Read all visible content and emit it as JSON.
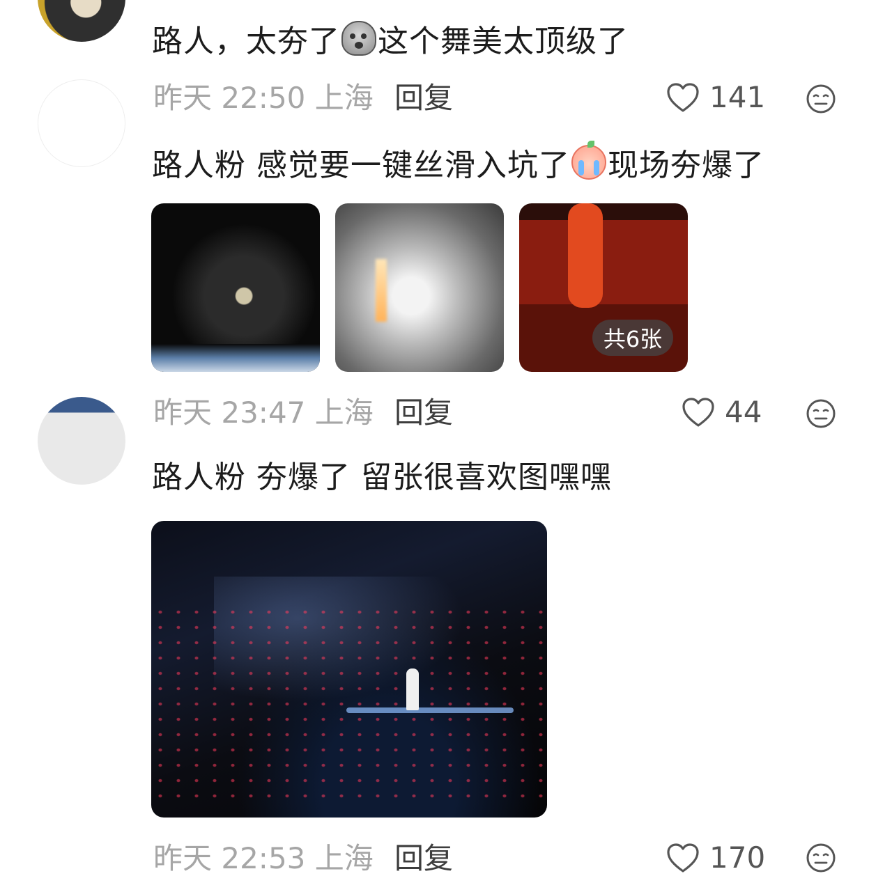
{
  "comments": [
    {
      "text_before": "路人，太夯了",
      "emoji": "ghost-emoji",
      "text_after": "这个舞美太顶级了",
      "meta": "昨天 22:50 上海",
      "reply": "回复",
      "likes": "141"
    },
    {
      "text_before": "路人粉 感觉要一键丝滑入坑了",
      "emoji": "crying-emoji",
      "text_after": "现场夯爆了",
      "images_badge": "共6张",
      "meta": "昨天 23:47 上海",
      "reply": "回复",
      "likes": "44"
    },
    {
      "text": "路人粉 夯爆了 留张很喜欢图嘿嘿",
      "meta": "昨天 22:53 上海",
      "reply": "回复",
      "likes": "170"
    }
  ],
  "colors": {
    "text": "#1c1c1c",
    "meta": "#a6a6a6",
    "reply": "#3d3d3d",
    "icon": "#555555"
  }
}
